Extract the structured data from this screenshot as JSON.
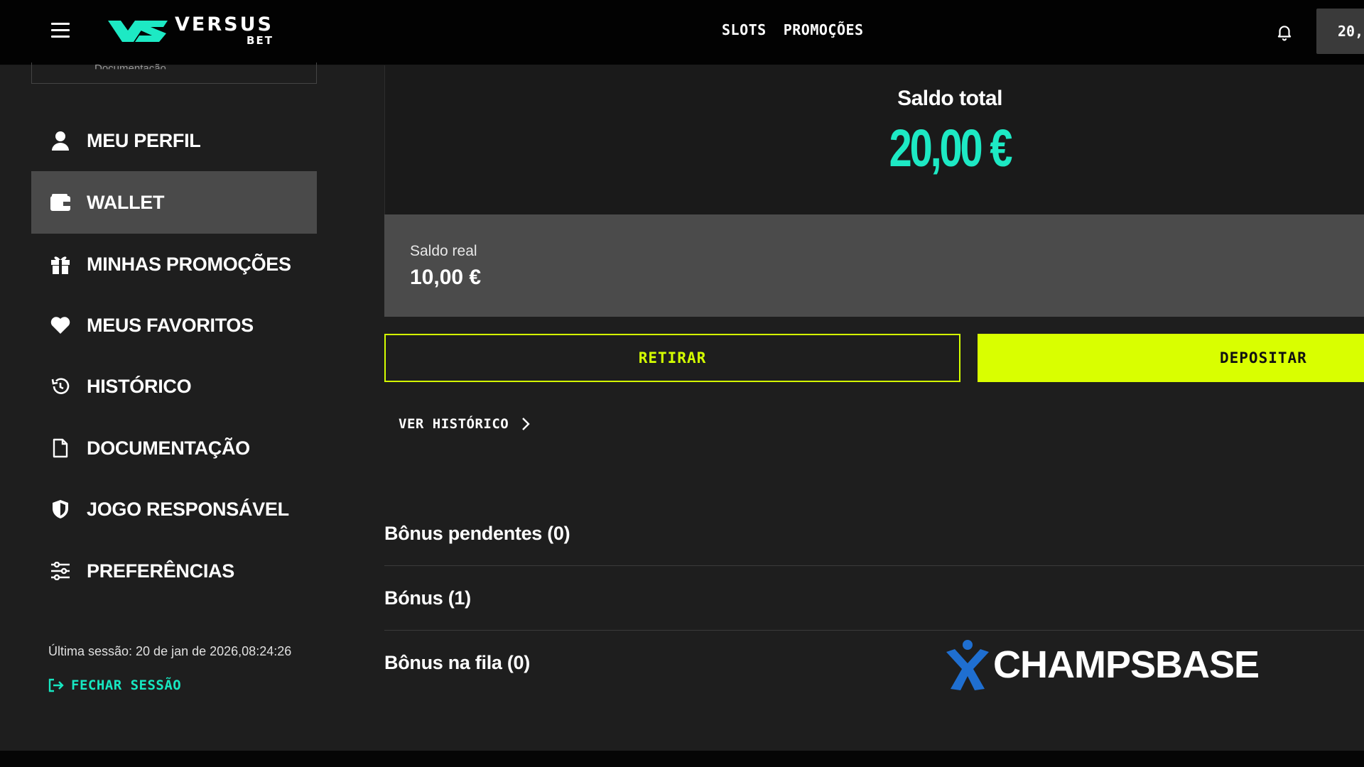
{
  "header": {
    "logo_main": "VERSUS",
    "logo_sub": "BET",
    "nav": [
      "SLOTS",
      "PROMOÇÕES"
    ],
    "balance_chip": "20,"
  },
  "sidebar": {
    "doc_box_text": "Documentação",
    "items": [
      {
        "label": "MEU PERFIL",
        "icon": "user-icon"
      },
      {
        "label": "WALLET",
        "icon": "wallet-icon"
      },
      {
        "label": "MINHAS PROMOÇÕES",
        "icon": "gift-icon"
      },
      {
        "label": "MEUS FAVORITOS",
        "icon": "heart-icon"
      },
      {
        "label": "HISTÓRICO",
        "icon": "history-icon"
      },
      {
        "label": "DOCUMENTAÇÃO",
        "icon": "document-icon"
      },
      {
        "label": "JOGO RESPONSÁVEL",
        "icon": "shield-icon"
      },
      {
        "label": "PREFERÊNCIAS",
        "icon": "sliders-icon"
      }
    ],
    "active_item": "WALLET",
    "last_session": "Última sessão: 20 de jan de 2026,08:24:26",
    "logout_label": "FECHAR SESSÃO"
  },
  "wallet": {
    "total_label": "Saldo total",
    "total_value": "20,00 €",
    "real_label": "Saldo real",
    "real_value": "10,00 €",
    "withdraw_label": "RETIRAR",
    "deposit_label": "DEPOSITAR",
    "history_link": "VER HISTÓRICO",
    "bonus_rows": [
      "Bônus pendentes (0)",
      "Bónus (1)",
      "Bônus na fila (0)"
    ]
  },
  "watermark": {
    "text": "CHAMPSBASE"
  },
  "colors": {
    "accent_teal": "#1de9c4",
    "accent_lime": "#d9ff00",
    "sidebar_bg": "#1e1e1e",
    "active_item_bg": "#4a4a4a",
    "watermark_blue": "#1f6fd1"
  }
}
